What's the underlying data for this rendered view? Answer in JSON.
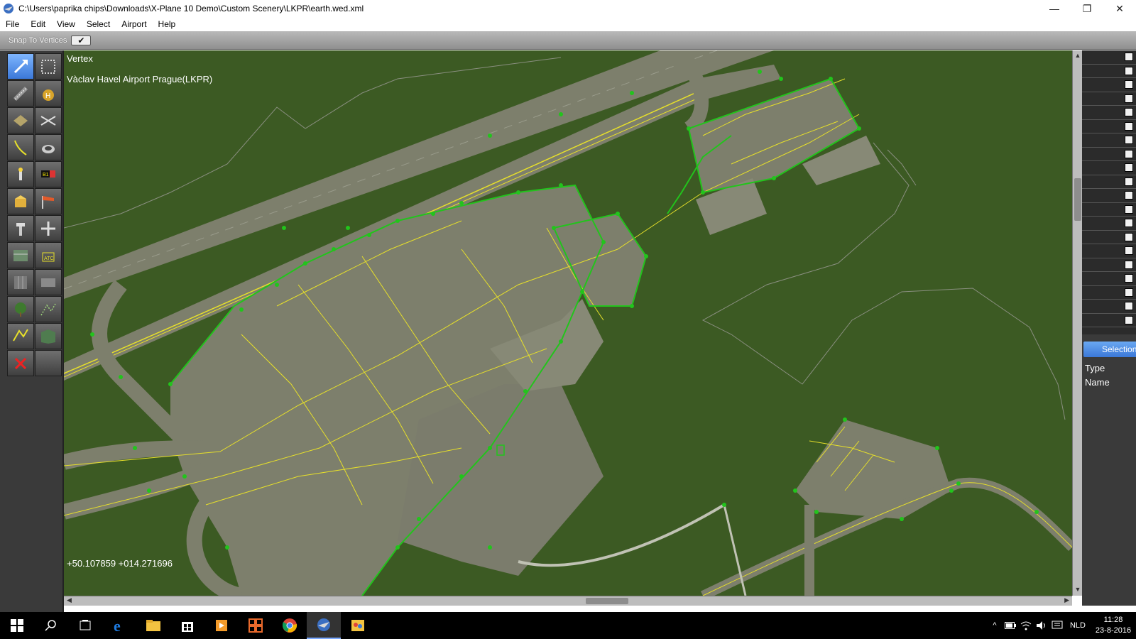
{
  "window": {
    "title": "C:\\Users\\paprika chips\\Downloads\\X-Plane 10 Demo\\Custom Scenery\\LKPR\\earth.wed.xml",
    "minimize": "—",
    "restore": "❐",
    "close": "✕"
  },
  "menu": [
    "File",
    "Edit",
    "View",
    "Select",
    "Airport",
    "Help"
  ],
  "options": {
    "snap_label": "Snap To Vertices",
    "snap_checked": "✔"
  },
  "tools": [
    {
      "icon": "vertex-tool-icon",
      "active": true
    },
    {
      "icon": "marquee-tool-icon"
    },
    {
      "icon": "runway-tool-icon"
    },
    {
      "icon": "helipad-tool-icon"
    },
    {
      "icon": "taxiway-tool-icon"
    },
    {
      "icon": "boundary-tool-icon"
    },
    {
      "icon": "taxi-line-tool-icon"
    },
    {
      "icon": "hole-tool-icon"
    },
    {
      "icon": "light-tool-icon"
    },
    {
      "icon": "sign-tool-icon"
    },
    {
      "icon": "object-tool-icon"
    },
    {
      "icon": "windsock-tool-icon"
    },
    {
      "icon": "tower-viewpoint-tool-icon"
    },
    {
      "icon": "ramp-start-tool-icon"
    },
    {
      "icon": "facade-tool-icon"
    },
    {
      "icon": "atc-flow-tool-icon"
    },
    {
      "icon": "forest-tool-icon"
    },
    {
      "icon": "string-tool-icon"
    },
    {
      "icon": "tree-tool-icon"
    },
    {
      "icon": "line-tool-icon"
    },
    {
      "icon": "polygon-path-tool-icon"
    },
    {
      "icon": "draped-polygon-tool-icon"
    },
    {
      "icon": "delete-tool-icon"
    },
    {
      "icon": "empty-tool-icon"
    }
  ],
  "map": {
    "mode": "Vertex",
    "airport": "Vàclav Havel Airport Prague(LKPR)",
    "coords": "+50.107859 +014.271696",
    "colors": {
      "grass": "#3c5a23",
      "pavement": "#7d7f6c",
      "taxiline": "#e7e02a",
      "vertex": "#22c41c"
    }
  },
  "right_panel": {
    "selection_tab": "Selection",
    "props": [
      "Type",
      "Name"
    ]
  },
  "taskbar": {
    "apps": [
      "start-icon",
      "search-icon",
      "task-view-icon",
      "edge-icon",
      "file-explorer-icon",
      "store-icon",
      "media-player-icon",
      "app-grid-icon",
      "chrome-icon",
      "wed-app-icon",
      "paint-icon"
    ],
    "language": "NLD",
    "time": "11:28",
    "date": "23-8-2016"
  }
}
